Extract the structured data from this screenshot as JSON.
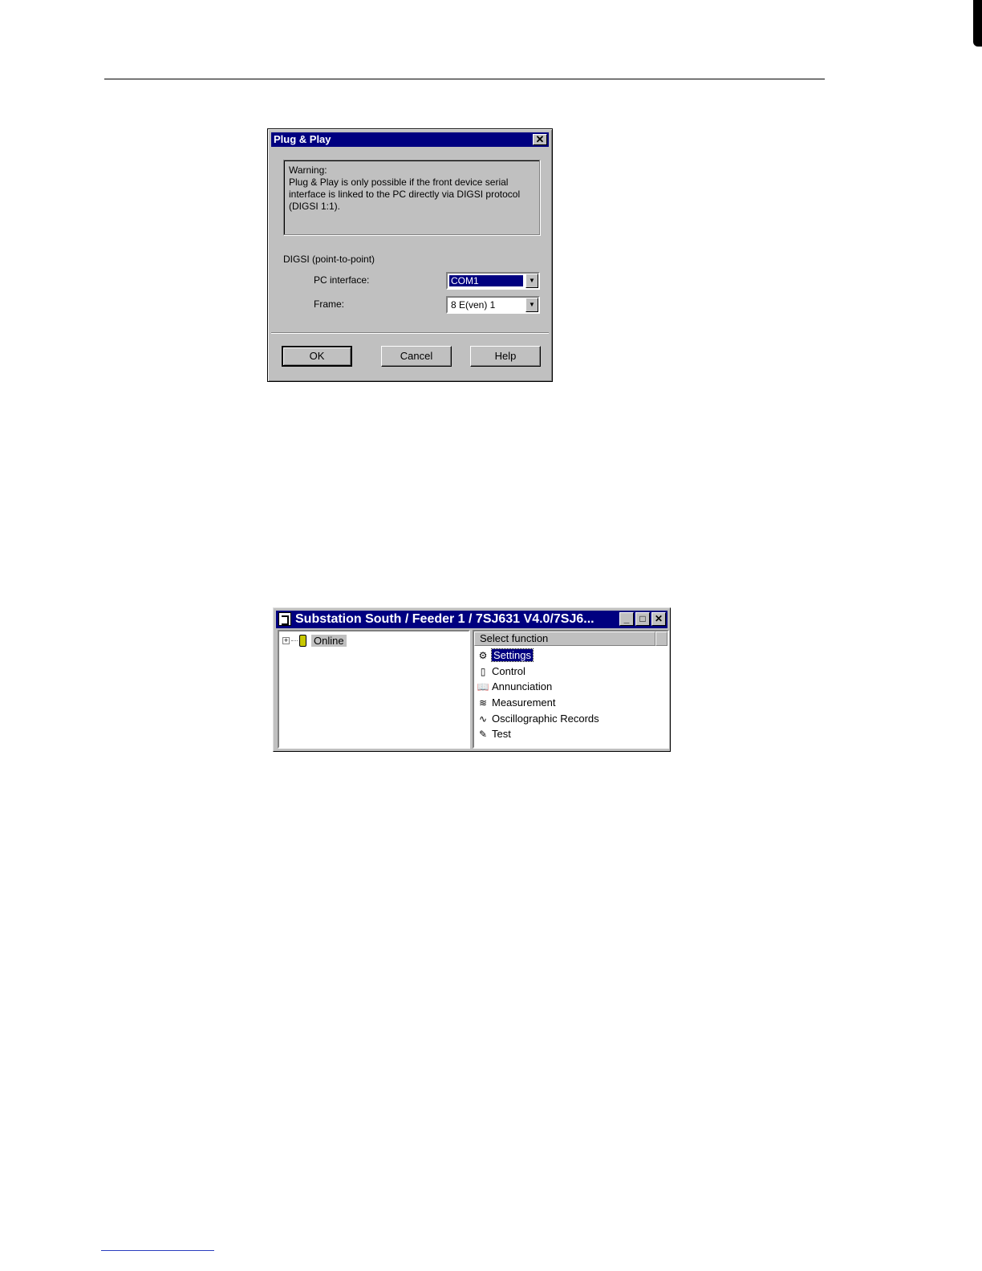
{
  "dialog": {
    "title": "Plug & Play",
    "close_glyph": "✕",
    "warning_heading": "Warning:",
    "warning_text": "Plug & Play is only possible if the front device serial interface is linked to the PC directly via DIGSI protocol (DIGSI 1:1).",
    "group_label": "DIGSI (point-to-point)",
    "pc_interface_label": "PC interface:",
    "pc_interface_value": "COM1",
    "frame_label": "Frame:",
    "frame_value": "8 E(ven) 1",
    "buttons": {
      "ok": "OK",
      "cancel": "Cancel",
      "help": "Help"
    }
  },
  "window": {
    "title": "Substation South / Feeder 1 / 7SJ631 V4.0/7SJ6...",
    "controls": {
      "minimize": "_",
      "maximize": "□",
      "close": "✕"
    },
    "tree": {
      "expander": "+",
      "node_label": "Online"
    },
    "list": {
      "header": "Select function",
      "items": [
        {
          "label": "Settings",
          "icon": "settings-icon",
          "glyph": "⚙",
          "selected": true
        },
        {
          "label": "Control",
          "icon": "control-icon",
          "glyph": "▯",
          "selected": false
        },
        {
          "label": "Annunciation",
          "icon": "annunciation-icon",
          "glyph": "📖",
          "selected": false
        },
        {
          "label": "Measurement",
          "icon": "measurement-icon",
          "glyph": "≋",
          "selected": false
        },
        {
          "label": "Oscillographic Records",
          "icon": "oscillographic-records-icon",
          "glyph": "∿",
          "selected": false
        },
        {
          "label": "Test",
          "icon": "test-icon",
          "glyph": "✎",
          "selected": false
        }
      ]
    }
  }
}
